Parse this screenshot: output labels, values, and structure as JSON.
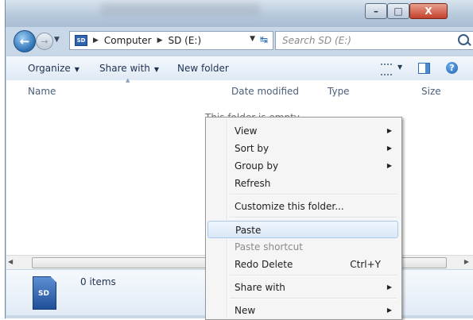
{
  "window": {
    "min_symbol": "–",
    "max_symbol": "□",
    "close_symbol": "X"
  },
  "nav": {
    "back_symbol": "←",
    "forward_symbol": "→",
    "breadcrumb": [
      "Computer",
      "SD (E:)"
    ],
    "sd_badge": "SD",
    "search_placeholder": "Search SD (E:)"
  },
  "toolbar": {
    "organize": "Organize",
    "share_with": "Share with",
    "new_folder": "New folder",
    "help_symbol": "?"
  },
  "columns": {
    "name": "Name",
    "date_modified": "Date modified",
    "type": "Type",
    "size": "Size"
  },
  "content": {
    "empty_message": "This folder is empty."
  },
  "details": {
    "icon_label": "SD",
    "items_count": "0 items"
  },
  "context_menu": {
    "items": [
      {
        "label": "View",
        "submenu": true
      },
      {
        "label": "Sort by",
        "submenu": true
      },
      {
        "label": "Group by",
        "submenu": true
      },
      {
        "label": "Refresh"
      },
      {
        "label": "Customize this folder..."
      },
      {
        "label": "Paste",
        "highlighted": true
      },
      {
        "label": "Paste shortcut",
        "disabled": true
      },
      {
        "label": "Redo Delete",
        "shortcut": "Ctrl+Y"
      },
      {
        "label": "Share with",
        "submenu": true
      },
      {
        "label": "New",
        "submenu": true
      }
    ]
  }
}
